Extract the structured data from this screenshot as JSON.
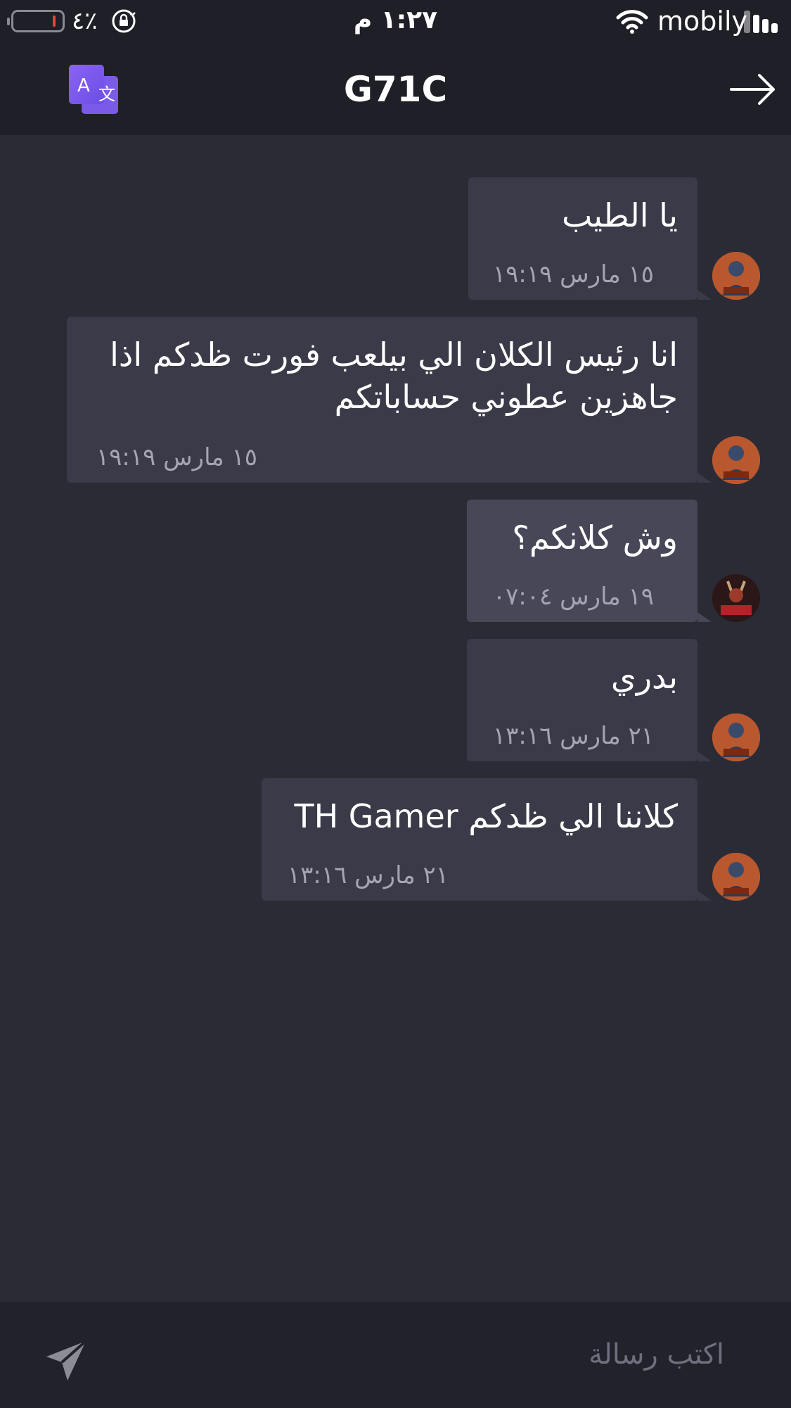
{
  "status_bar": {
    "battery_percent": "٤٪",
    "time": "١:٢٧ م",
    "carrier": "mobily",
    "battery_color": "#e0453a"
  },
  "header": {
    "title": "G71C",
    "left_icon": "translate-icon",
    "right_icon": "back-arrow-icon",
    "accent": "#7b5cf0"
  },
  "messages": [
    {
      "text": "يا الطيب",
      "time": "١٥ مارس ١٩:١٩",
      "avatar": "rust-lord"
    },
    {
      "text": "انا رئيس الكلان الي بيلعب فورت ظدكم اذا جاهزين عطوني حساباتكم",
      "time": "١٥ مارس ١٩:١٩",
      "avatar": "rust-lord"
    },
    {
      "text": "وش كلانكم؟",
      "time": "١٩ مارس ٠٧:٠٤",
      "avatar": "venom"
    },
    {
      "text": "بدري",
      "time": "٢١ مارس ١٣:١٦",
      "avatar": "rust-lord"
    },
    {
      "text": "كلاننا الي ظدكم TH Gamer",
      "time": "٢١ مارس ١٣:١٦",
      "avatar": "rust-lord"
    }
  ],
  "composer": {
    "placeholder": "اكتب رسالة",
    "send_icon": "send-icon"
  }
}
